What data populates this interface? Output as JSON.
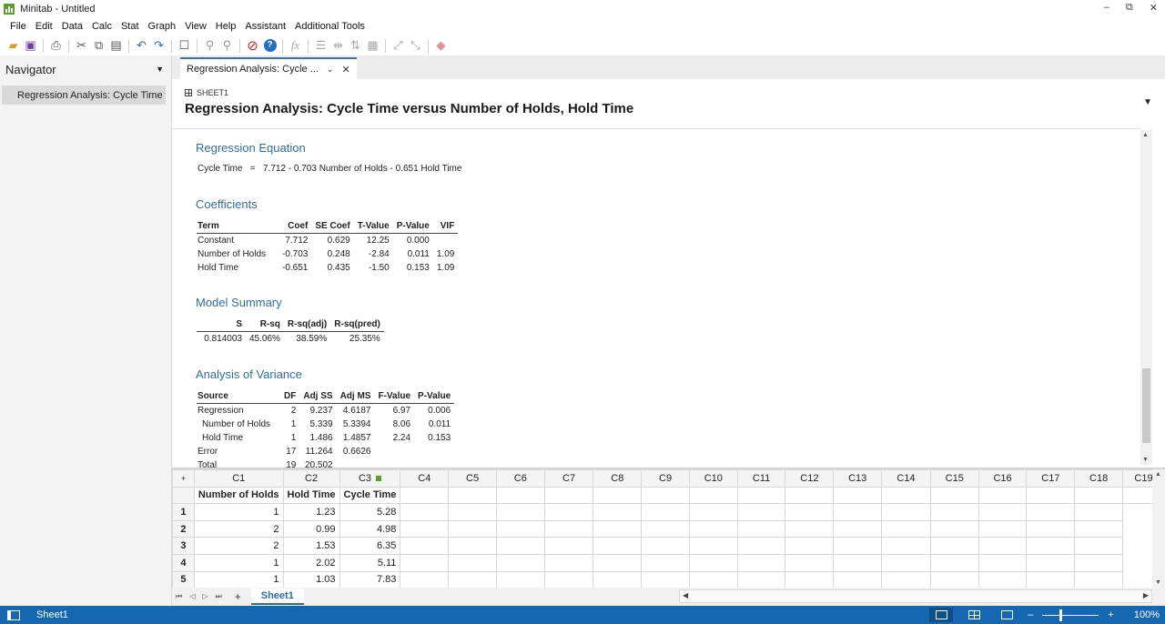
{
  "window": {
    "title": "Minitab - Untitled",
    "controls": [
      "–",
      "⧉",
      "✕"
    ]
  },
  "menu": [
    "File",
    "Edit",
    "Data",
    "Calc",
    "Stat",
    "Graph",
    "View",
    "Help",
    "Assistant",
    "Additional Tools"
  ],
  "toolbar": {
    "icons": [
      "open-icon",
      "save-icon",
      "print-icon",
      "cut-icon",
      "copy-icon",
      "paste-icon",
      "undo-icon",
      "redo-icon",
      "new-window-icon",
      "find-icon",
      "replace-icon",
      "cancel-icon",
      "help-icon",
      "formula-icon",
      "insert-rows-icon",
      "insert-columns-icon",
      "move-columns-icon",
      "column-properties-icon",
      "brush-icon",
      "set-id-icon",
      "eraser-icon"
    ]
  },
  "navigator": {
    "title": "Navigator",
    "items": [
      "Regression Analysis: Cycle Time ve..."
    ]
  },
  "output_tab": {
    "label": "Regression Analysis: Cycle ...",
    "sheet_label": "SHEET1",
    "title": "Regression Analysis: Cycle Time versus Number of Holds, Hold Time"
  },
  "report": {
    "equation": {
      "heading": "Regression Equation",
      "lhs": "Cycle Time",
      "eq_sign": "=",
      "rhs": "7.712 - 0.703 Number of Holds - 0.651 Hold Time"
    },
    "coefficients": {
      "heading": "Coefficients",
      "columns": [
        "Term",
        "Coef",
        "SE Coef",
        "T-Value",
        "P-Value",
        "VIF"
      ],
      "rows": [
        [
          "Constant",
          "7.712",
          "0.629",
          "12.25",
          "0.000",
          ""
        ],
        [
          "Number of Holds",
          "-0.703",
          "0.248",
          "-2.84",
          "0.011",
          "1.09"
        ],
        [
          "Hold Time",
          "-0.651",
          "0.435",
          "-1.50",
          "0.153",
          "1.09"
        ]
      ]
    },
    "model_summary": {
      "heading": "Model Summary",
      "columns": [
        "S",
        "R-sq",
        "R-sq(adj)",
        "R-sq(pred)"
      ],
      "rows": [
        [
          "0.814003",
          "45.06%",
          "38.59%",
          "25.35%"
        ]
      ]
    },
    "anova": {
      "heading": "Analysis of Variance",
      "columns": [
        "Source",
        "DF",
        "Adj SS",
        "Adj MS",
        "F-Value",
        "P-Value"
      ],
      "rows": [
        [
          "Regression",
          "2",
          "9.237",
          "4.6187",
          "6.97",
          "0.006"
        ],
        [
          "Number of Holds",
          "1",
          "5.339",
          "5.3394",
          "8.06",
          "0.011"
        ],
        [
          "Hold Time",
          "1",
          "1.486",
          "1.4857",
          "2.24",
          "0.153"
        ],
        [
          "Error",
          "17",
          "11.264",
          "0.6626",
          "",
          ""
        ],
        [
          "Total",
          "19",
          "20.502",
          "",
          "",
          ""
        ]
      ]
    }
  },
  "worksheet": {
    "columns": [
      "C1",
      "C2",
      "C3",
      "C4",
      "C5",
      "C6",
      "C7",
      "C8",
      "C9",
      "C10",
      "C11",
      "C12",
      "C13",
      "C14",
      "C15",
      "C16",
      "C17",
      "C18",
      "C19"
    ],
    "names": [
      "Number of Holds",
      "Hold Time",
      "Cycle Time"
    ],
    "rows": [
      [
        "1",
        "1",
        "1.23",
        "5.28"
      ],
      [
        "2",
        "2",
        "0.99",
        "4.98"
      ],
      [
        "3",
        "2",
        "1.53",
        "6.35"
      ],
      [
        "4",
        "1",
        "2.02",
        "5.11"
      ],
      [
        "5",
        "1",
        "1.03",
        "7.83"
      ]
    ],
    "sheet_tab": "Sheet1",
    "add_label": "+"
  },
  "status": {
    "sheet": "Sheet1",
    "zoom": "100%",
    "zoom_minus": "–",
    "zoom_plus": "+"
  }
}
